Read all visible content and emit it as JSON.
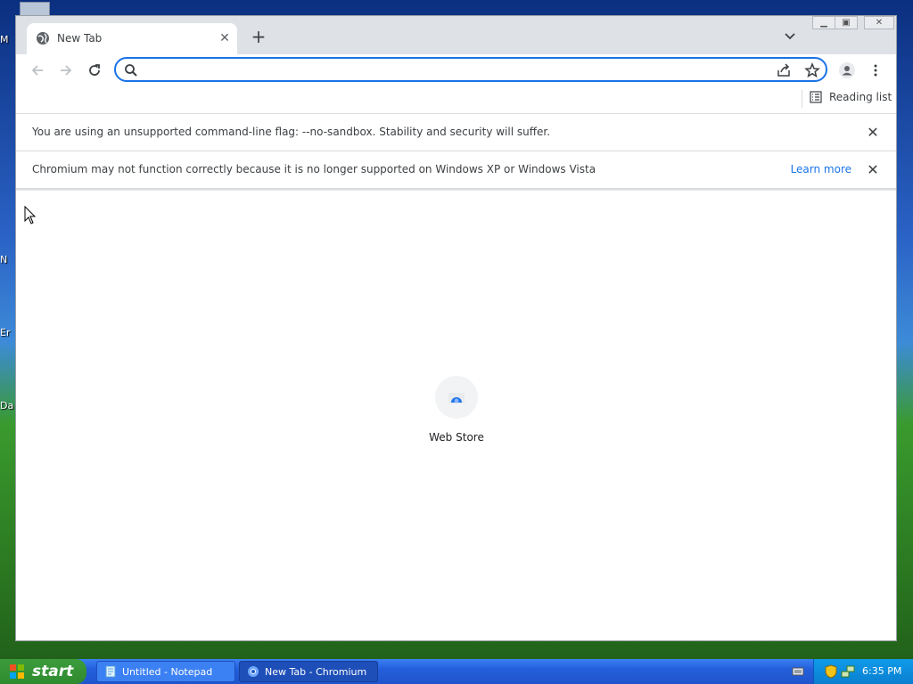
{
  "desktop": {
    "icon_labels": [
      "M",
      "N",
      "Er",
      "Da"
    ]
  },
  "tab": {
    "title": "New Tab"
  },
  "omnibox": {
    "value": ""
  },
  "bookmarks": {
    "reading_list_label": "Reading list"
  },
  "infobars": [
    {
      "message": "You are using an unsupported command-line flag: --no-sandbox. Stability and security will suffer."
    },
    {
      "message": "Chromium may not function correctly because it is no longer supported on Windows XP or Windows Vista",
      "link_label": "Learn more"
    }
  ],
  "ntp": {
    "shortcut_label": "Web Store"
  },
  "taskbar": {
    "start_label": "start",
    "tasks": [
      {
        "label": "Untitled - Notepad"
      },
      {
        "label": "New Tab - Chromium"
      }
    ],
    "clock": "6:35 PM"
  },
  "colors": {
    "accent": "#1a73e8",
    "tabstrip_bg": "#dee1e6",
    "taskbar_blue": "#245edb",
    "start_green": "#3c9c3c"
  }
}
